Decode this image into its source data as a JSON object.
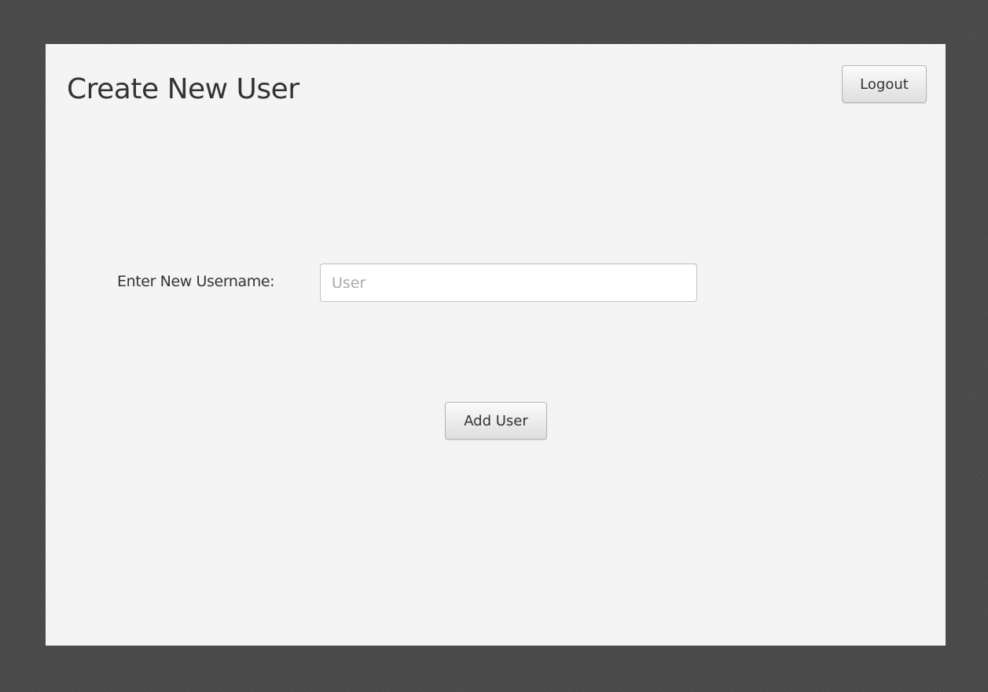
{
  "page": {
    "title": "Create New User"
  },
  "header": {
    "logout_label": "Logout"
  },
  "form": {
    "username_label": "Enter New Username:",
    "username_placeholder": "User",
    "username_value": "",
    "submit_label": "Add User"
  },
  "colors": {
    "backdrop": "#4a4a4a",
    "window_background": "#f4f4f4",
    "text": "#333333",
    "placeholder": "#a9a9a9"
  }
}
